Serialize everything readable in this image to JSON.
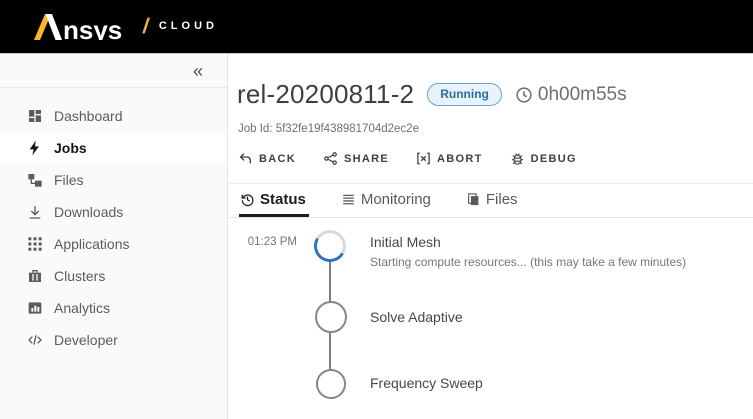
{
  "topbar": {
    "brand_rest": "nsys",
    "separator": "/",
    "product": "CLOUD",
    "accent_color": "#ffb71b"
  },
  "sidebar": {
    "collapse": "«",
    "items": [
      {
        "label": "Dashboard",
        "icon": "dashboard-icon",
        "active": false
      },
      {
        "label": "Jobs",
        "icon": "jobs-icon",
        "active": true
      },
      {
        "label": "Files",
        "icon": "files-icon",
        "active": false
      },
      {
        "label": "Downloads",
        "icon": "downloads-icon",
        "active": false
      },
      {
        "label": "Applications",
        "icon": "applications-icon",
        "active": false
      },
      {
        "label": "Clusters",
        "icon": "clusters-icon",
        "active": false
      },
      {
        "label": "Analytics",
        "icon": "analytics-icon",
        "active": false
      },
      {
        "label": "Developer",
        "icon": "developer-icon",
        "active": false
      }
    ]
  },
  "job": {
    "title": "rel-20200811-2",
    "status": "Running",
    "elapsed": "0h00m55s",
    "job_id": "Job Id: 5f32fe19f438981704d2ec2e"
  },
  "actions": {
    "back": "BACK",
    "share": "SHARE",
    "abort": "ABORT",
    "debug": "DEBUG"
  },
  "tabs": {
    "status": "Status",
    "monitoring": "Monitoring",
    "files": "Files",
    "active": "Status"
  },
  "timeline": {
    "steps": [
      {
        "time": "01:23 PM",
        "title": "Initial Mesh",
        "subtitle": "Starting compute resources... (this may take a few minutes)",
        "state": "running"
      },
      {
        "time": "",
        "title": "Solve Adaptive",
        "subtitle": "",
        "state": "pending"
      },
      {
        "time": "",
        "title": "Frequency Sweep",
        "subtitle": "",
        "state": "pending"
      }
    ]
  },
  "colors": {
    "badge_bg": "#e8f2fb",
    "badge_border": "#69a2d4",
    "badge_text": "#2a6fa8",
    "running_blue": "#2577c0",
    "brand_gold": "#ffb71b"
  }
}
